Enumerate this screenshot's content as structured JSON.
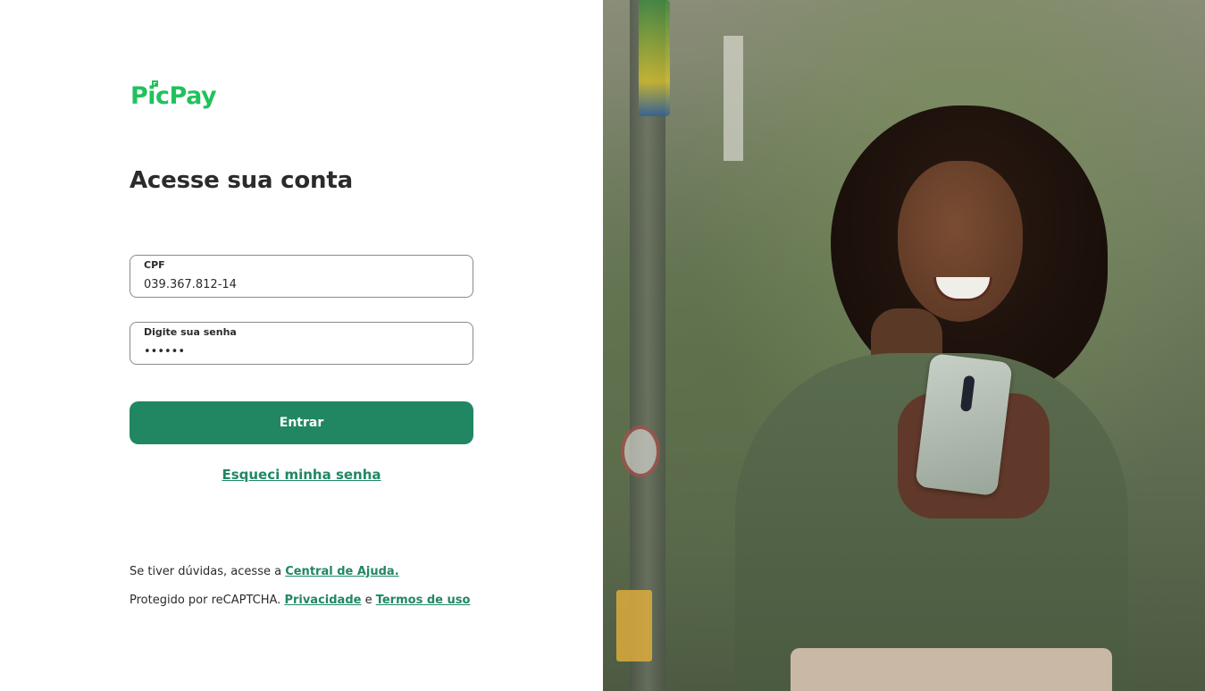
{
  "brand": {
    "logo_text": "PicPay",
    "color": "#21c25e"
  },
  "login": {
    "title": "Acesse sua conta",
    "cpf": {
      "label": "CPF",
      "value": "039.367.812-14"
    },
    "senha": {
      "label": "Digite sua senha",
      "value": "••••••"
    },
    "submit_label": "Entrar",
    "forgot_label": "Esqueci minha senha",
    "accent_color": "#218762"
  },
  "footer": {
    "help_prefix": "Se tiver dúvidas, acesse a ",
    "help_link": "Central de Ajuda.",
    "recaptcha_prefix": "Protegido por reCAPTCHA. ",
    "privacy_link": "Privacidade",
    "conjunction": " e ",
    "terms_link": "Termos de uso"
  },
  "hero": {
    "icon": "woman-smiling-with-phone-photo"
  }
}
